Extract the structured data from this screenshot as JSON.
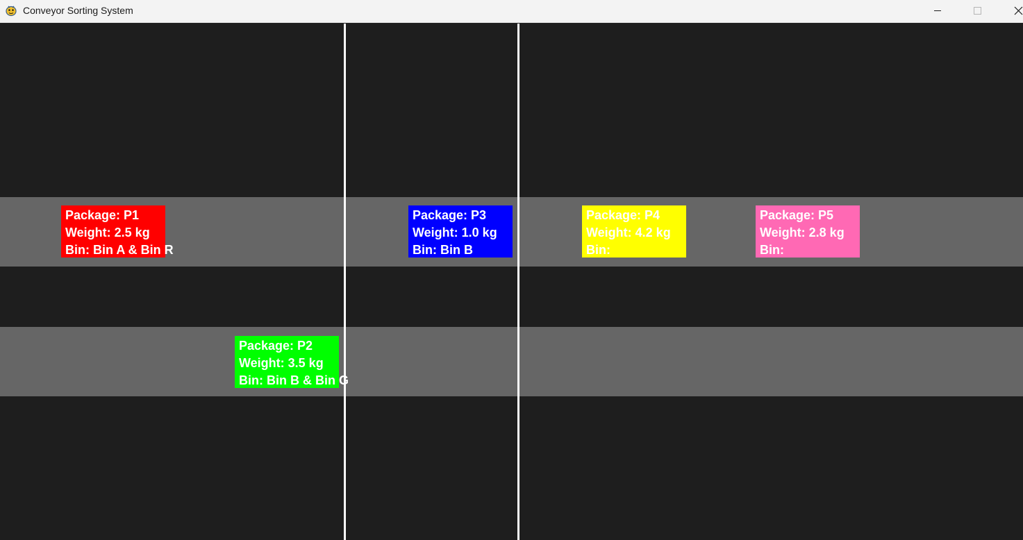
{
  "window": {
    "title": "Conveyor Sorting System",
    "icon": "pygame-snake-icon",
    "controls": {
      "minimize": "minimize-icon",
      "maximize": "maximize-icon",
      "close": "close-icon"
    }
  },
  "colors": {
    "background": "#1e1e1e",
    "belt": "#666666",
    "divider": "#ffffff",
    "text": "#ffffff"
  },
  "belts": [
    "belt-1",
    "belt-2"
  ],
  "packages": [
    {
      "id": "p1",
      "color": "#ff0000",
      "line1": "Package: P1",
      "line2": "Weight: 2.5 kg",
      "line3": "Bin: Bin A & Bin R"
    },
    {
      "id": "p2",
      "color": "#00ff00",
      "line1": "Package: P2",
      "line2": "Weight: 3.5 kg",
      "line3": "Bin: Bin B & Bin G"
    },
    {
      "id": "p3",
      "color": "#0000ff",
      "line1": "Package: P3",
      "line2": "Weight: 1.0 kg",
      "line3": "Bin: Bin B"
    },
    {
      "id": "p4",
      "color": "#ffff00",
      "line1": "Package: P4",
      "line2": "Weight: 4.2 kg",
      "line3": "Bin:"
    },
    {
      "id": "p5",
      "color": "#ff69b4",
      "line1": "Package: P5",
      "line2": "Weight: 2.8 kg",
      "line3": "Bin:"
    }
  ]
}
